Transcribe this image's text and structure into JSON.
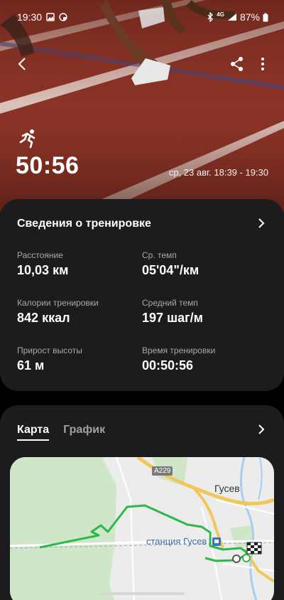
{
  "status_bar": {
    "time": "19:30",
    "network": "4G",
    "battery": "87%"
  },
  "workout": {
    "duration": "50:56",
    "date_range": "ср, 23 авг. 18:39 - 19:30"
  },
  "details": {
    "title": "Сведения о тренировке",
    "stats": [
      {
        "label": "Расстояние",
        "value": "10,03",
        "unit": "км"
      },
      {
        "label": "Ср. темп",
        "value": "05'04\"",
        "unit": "/км"
      },
      {
        "label": "Калории тренировки",
        "value": "842",
        "unit": "ккал"
      },
      {
        "label": "Средний темп",
        "value": "197",
        "unit": "шаг/м"
      },
      {
        "label": "Прирост высоты",
        "value": "61",
        "unit": "м"
      },
      {
        "label": "Время тренировки",
        "value": "00:50:56",
        "unit": ""
      }
    ]
  },
  "map_card": {
    "tabs": [
      {
        "label": "Карта",
        "active": true
      },
      {
        "label": "График",
        "active": false
      }
    ],
    "map": {
      "city_label": "Гусев",
      "station_label": "станция Гусев",
      "road_badge": "A229",
      "route_color": "#2db84b"
    }
  },
  "icons": {
    "back": "arrow-left",
    "share": "share",
    "more": "more-vertical",
    "workout_type": "running",
    "details_link": "chevron-right",
    "map_link": "chevron-right"
  },
  "colors": {
    "card_bg": "#1c1c1e",
    "track": "#7a2c20",
    "route": "#2db84b"
  }
}
